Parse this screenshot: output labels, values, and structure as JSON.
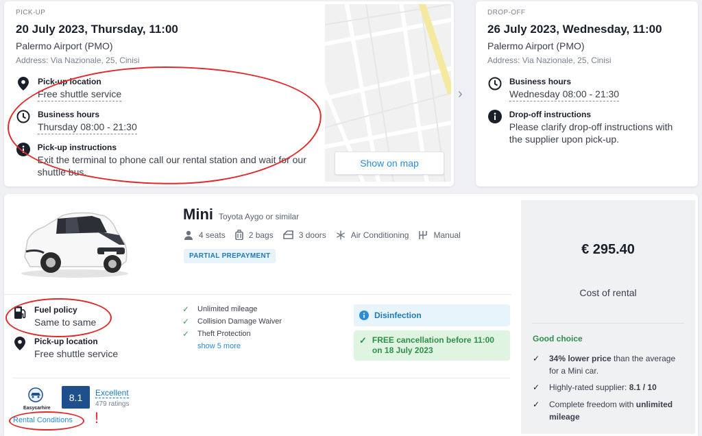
{
  "pickup": {
    "section_label": "PICK-UP",
    "date": "20 July 2023, Thursday, 11:00",
    "location": "Palermo Airport (PMO)",
    "address": "Address: Via Nazionale, 25, Cinisi",
    "pickup_location_title": "Pick-up location",
    "pickup_location_value": "Free shuttle service",
    "hours_title": "Business hours",
    "hours_value": "Thursday 08:00 - 21:30",
    "instructions_title": "Pick-up instructions",
    "instructions_value": "Exit the terminal to phone call our rental station and wait for our shuttle bus.",
    "map_button": "Show on map"
  },
  "dropoff": {
    "section_label": "DROP-OFF",
    "date": "26 July 2023, Wednesday, 11:00",
    "location": "Palermo Airport (PMO)",
    "address": "Address: Via Nazionale, 25, Cinisi",
    "hours_title": "Business hours",
    "hours_value": "Wednesday 08:00 - 21:30",
    "instructions_title": "Drop-off instructions",
    "instructions_value": "Please clarify drop-off instructions with the supplier upon pick-up."
  },
  "car": {
    "category": "Mini",
    "model": "Toyota Aygo or similar",
    "features": [
      {
        "icon": "person-icon",
        "label": "4 seats"
      },
      {
        "icon": "bag-icon",
        "label": "2 bags"
      },
      {
        "icon": "door-icon",
        "label": "3 doors"
      },
      {
        "icon": "snowflake-icon",
        "label": "Air Conditioning"
      },
      {
        "icon": "gearbox-icon",
        "label": "Manual"
      }
    ],
    "prepayment_badge": "PARTIAL PREPAYMENT",
    "fuel_policy_title": "Fuel policy",
    "fuel_policy_value": "Same to same",
    "pickup_location_title": "Pick-up location",
    "pickup_location_value": "Free shuttle service",
    "inclusions": [
      "Unlimited mileage",
      "Collision Damage Waiver",
      "Theft Protection"
    ],
    "show_more": "show 5 more",
    "disinfection": "Disinfection",
    "free_cancellation": "FREE cancellation before 11:00 on 18 July 2023"
  },
  "supplier": {
    "logo_text": "Easycarhire",
    "rating": "8.1",
    "rating_label": "Excellent",
    "ratings_count": "479 ratings",
    "rental_conditions": "Rental Conditions",
    "annotation_mark": "!"
  },
  "price": {
    "amount": "€ 295.40",
    "label": "Cost of rental",
    "good_choice": "Good choice",
    "points": [
      {
        "bold": "34% lower price",
        "rest": " than the average for a Mini car."
      },
      {
        "pre": "Highly-rated supplier: ",
        "bold": "8.1 / 10"
      },
      {
        "pre": "Complete freedom with ",
        "bold": "unlimited mileage"
      }
    ]
  },
  "colors": {
    "accent_blue": "#2a8dd6",
    "rating_bg": "#1f4f8c",
    "green": "#3aa25a",
    "annotation_red": "#e02a2a"
  }
}
